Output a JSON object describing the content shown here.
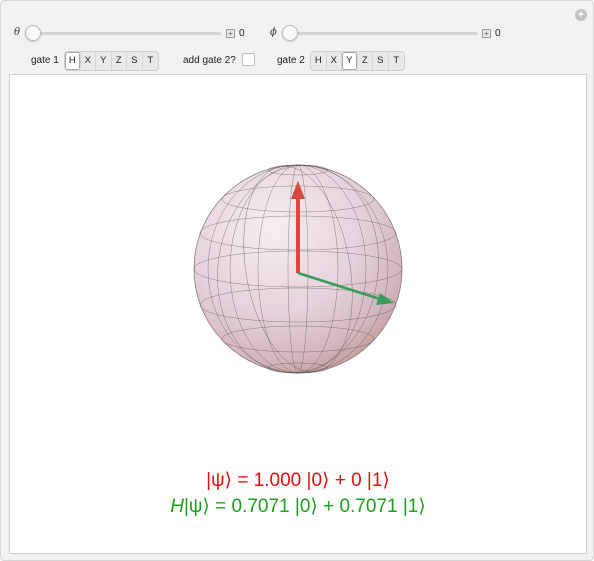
{
  "controls": {
    "theta_symbol": "θ",
    "theta_value": "0",
    "phi_symbol": "ϕ",
    "phi_value": "0",
    "gate1_label": "gate 1",
    "gate1_options": [
      "H",
      "X",
      "Y",
      "Z",
      "S",
      "T"
    ],
    "gate1_selected": "H",
    "add_gate2_label": "add gate 2?",
    "add_gate2_checked": false,
    "gate2_label": "gate 2",
    "gate2_options": [
      "H",
      "X",
      "Y",
      "Z",
      "S",
      "T"
    ],
    "gate2_selected": "Y"
  },
  "output": {
    "state_line": "|ψ⟩ = 1.000 |0⟩ + 0 |1⟩",
    "gate_prefix": "H",
    "gate_line_rest": "|ψ⟩ = 0.7071 |0⟩ + 0.7071 |1⟩"
  },
  "colors": {
    "state_color": "#e01010",
    "transformed_color": "#1e9f1e"
  }
}
